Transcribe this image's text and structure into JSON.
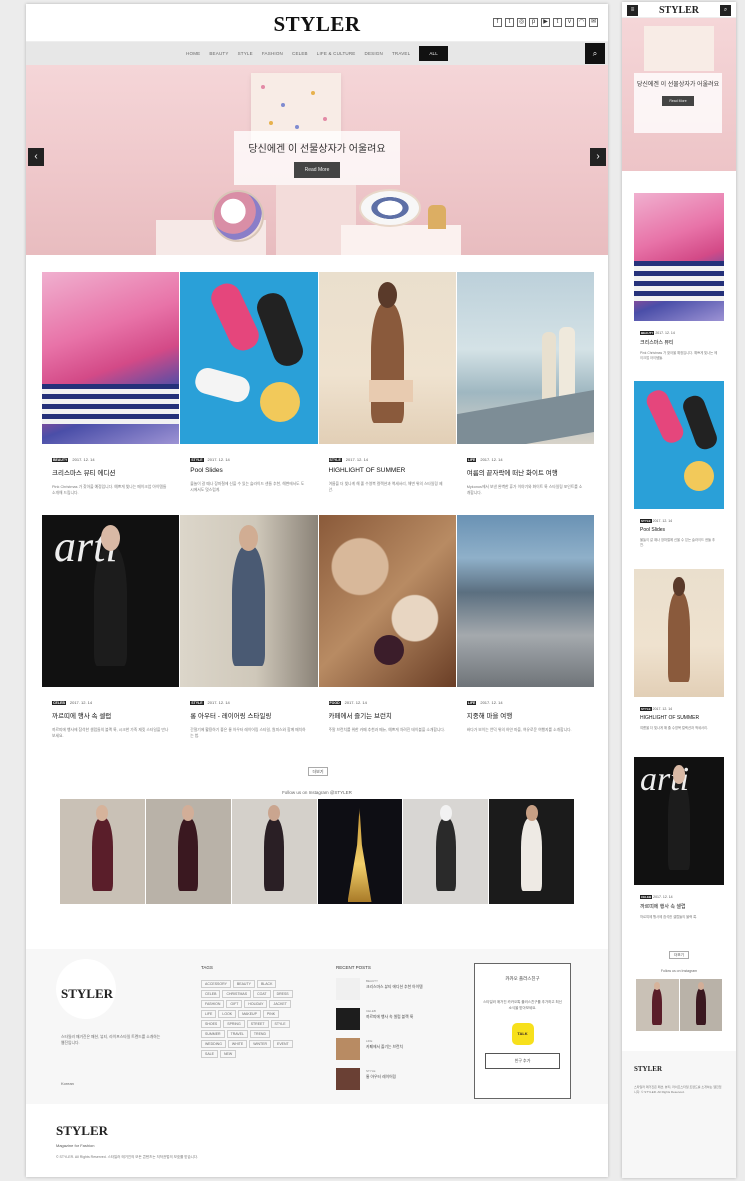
{
  "brand": "STYLER",
  "header": {
    "social_icons": [
      "facebook-icon",
      "twitter-icon",
      "instagram-icon",
      "pinterest-icon",
      "youtube-icon",
      "tumblr-icon",
      "vimeo-icon",
      "rss-icon",
      "email-icon"
    ]
  },
  "nav": {
    "items": [
      "HOME",
      "BEAUTY",
      "STYLE",
      "FASHION",
      "CELEB",
      "LIFE & CULTURE",
      "DESIGN",
      "TRAVEL"
    ],
    "active": "ALL"
  },
  "hero": {
    "title": "당신에겐 이 선물상자가 어울려요",
    "button": "Read More"
  },
  "posts": [
    {
      "cat": "BEAUTY",
      "date": "2017. 12. 14",
      "title": "크리스마스 뷰티 에디션",
      "excerpt": "Pink Christmas 가 찾아올 예정입니다. 예쁘게 빛나는 메이크업 아이템들 소개해 드립니다."
    },
    {
      "cat": "STYLE",
      "date": "2017. 12. 14",
      "title": "Pool Slides",
      "excerpt": "물놀이 갈 때나 장마철에 신을 수 있는 슬라이드 샌들 추천, 해변에서도 도시에서도 멋스럽게."
    },
    {
      "cat": "STYLE",
      "date": "2017. 12. 14",
      "title": "HIGHLIGHT OF SUMMER",
      "excerpt": "여름을 더 빛나게 해 줄 수영복 컬렉션과 액세서리, 해변 위의 스타일링 제안."
    },
    {
      "cat": "LIFE",
      "date": "2017. 12. 14",
      "title": "여름의 끝자락에 떠난 화이트 여행",
      "excerpt": "Mykonos에서 보낸 완벽한 휴가 이야기와 화이트 룩 스타일링 포인트를 소개합니다."
    },
    {
      "cat": "CELEB",
      "date": "2017. 12. 14",
      "title": "까르띠에 행사 속 셀럽",
      "excerpt": "까르띠에 행사에 참석한 셀럽들의 블랙 룩, 시크한 가죽 재킷 스타일을 만나보세요."
    },
    {
      "cat": "STYLE",
      "date": "2017. 12. 14",
      "title": "롱 아우터 - 레이어링 스타일링",
      "excerpt": "간절기에 활용하기 좋은 롱 아우터 레이어링 스타일, 원피스와 함께 매치하는 법."
    },
    {
      "cat": "FOOD",
      "date": "2017. 12. 14",
      "title": "카페에서 즐기는 브런치",
      "excerpt": "주말 브런치를 위한 카페 추천과 메뉴, 예쁘게 차려진 테이블을 소개합니다."
    },
    {
      "cat": "LIFE",
      "date": "2017. 12. 14",
      "title": "지중해 마을 여행",
      "excerpt": "바다가 보이는 언덕 위의 하얀 마을, 여유로운 여행지를 소개합니다."
    }
  ],
  "load_more": "더보기",
  "instagram": {
    "title": "Follow us on Instagram @STYLER"
  },
  "footer": {
    "description": "스타일러 매거진은 패션, 뷰티, 라이프스타일 트렌드를 소개하는 웹진입니다.",
    "language": "Korean",
    "tags_heading": "TAGS",
    "tags": [
      "ACCESSORY",
      "BEAUTY",
      "BLACK",
      "CELEB",
      "CHRISTMAS",
      "COAT",
      "DRESS",
      "FASHION",
      "GIFT",
      "HOLIDAY",
      "JACKET",
      "LIFE",
      "LOOK",
      "MAKEUP",
      "PINK",
      "SHOES",
      "SPRING",
      "STREET",
      "STYLE",
      "SUMMER",
      "TRAVEL",
      "TREND",
      "WEDDING",
      "WHITE",
      "WINTER",
      "EVENT",
      "SALE",
      "NEW"
    ],
    "recent_heading": "RECENT POSTS",
    "recent": [
      {
        "cat": "BEAUTY",
        "title": "크리스마스 뷰티 에디션 추천 아이템"
      },
      {
        "cat": "CELEB",
        "title": "까르띠에 행사 속 셀럽 블랙 룩"
      },
      {
        "cat": "LIFE",
        "title": "카페에서 즐기는 브런치"
      },
      {
        "cat": "STYLE",
        "title": "롱 아우터 레이어링"
      }
    ],
    "kakao": {
      "heading": "카카오 플러스친구",
      "text": "스타일러 매거진 카카오톡 플러스친구를 추가하고 최신 소식을 받아보세요.",
      "icon_label": "TALK",
      "button": "친구 추가"
    }
  },
  "bottom": {
    "logo": "STYLER",
    "tagline": "Magazine for Fashion",
    "copyright": "© STYLER. All Rights Reserved. 스타일러 매거진의 모든 콘텐츠는 저작권법의 보호를 받습니다."
  },
  "mobile": {
    "hero_title": "당신에겐 이 선물상자가 어울려요",
    "hero_button": "Read More",
    "posts": [
      {
        "cat": "BEAUTY",
        "date": "2017. 12. 14",
        "title": "크리스마스 뷰티",
        "excerpt": "Pink Christmas 가 찾아올 예정입니다. 예쁘게 빛나는 메이크업 아이템들."
      },
      {
        "cat": "STYLE",
        "date": "2017. 12. 14",
        "title": "Pool Slides",
        "excerpt": "물놀이 갈 때나 장마철에 신을 수 있는 슬라이드 샌들 추천."
      },
      {
        "cat": "STYLE",
        "date": "2017. 12. 14",
        "title": "HIGHLIGHT OF SUMMER",
        "excerpt": "여름을 더 빛나게 해 줄 수영복 컬렉션과 액세서리."
      },
      {
        "cat": "CELEB",
        "date": "2017. 12. 14",
        "title": "까르띠에 행사 속 셀럽",
        "excerpt": "까르띠에 행사에 참석한 셀럽들의 블랙 룩."
      }
    ],
    "load_more": "더보기",
    "insta_title": "Follow us on Instagram",
    "footer_logo": "STYLER",
    "footer_text": "스타일러 매거진은 패션, 뷰티, 라이프스타일 트렌드를 소개하는 웹진입니다. © STYLER. All Rights Reserved."
  },
  "colors": {
    "accent": "#111111",
    "hero_pink": "#efc8cb",
    "kakao_yellow": "#f7e01c",
    "nav_bg": "#e7e7e7"
  }
}
